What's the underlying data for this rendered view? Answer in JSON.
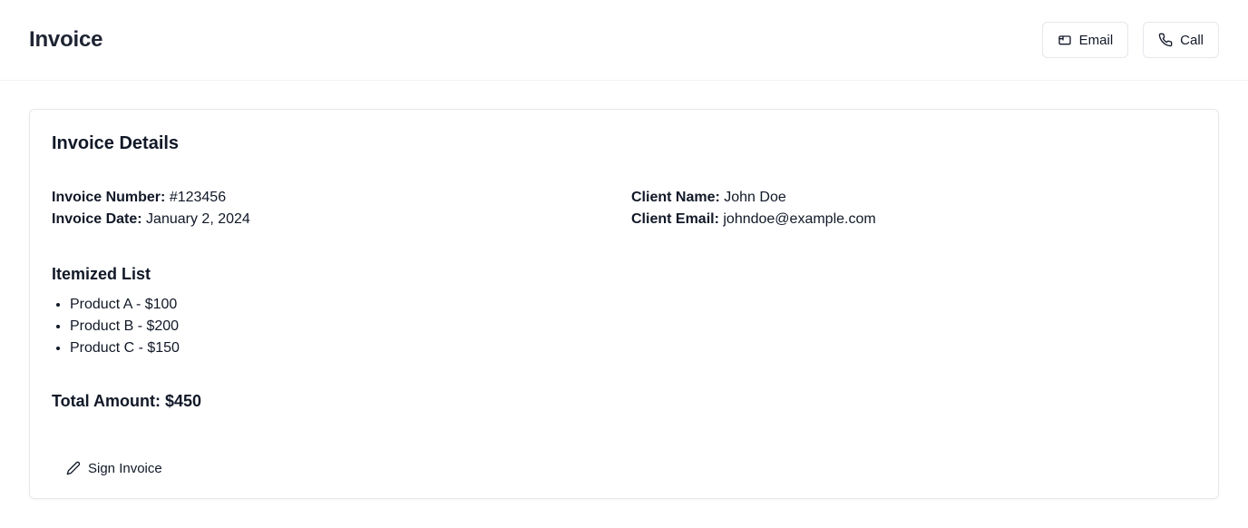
{
  "header": {
    "title": "Invoice",
    "email_label": "Email",
    "call_label": "Call"
  },
  "card": {
    "title": "Invoice Details",
    "invoice_number_label": "Invoice Number:",
    "invoice_number_value": "#123456",
    "invoice_date_label": "Invoice Date:",
    "invoice_date_value": "January 2, 2024",
    "client_name_label": "Client Name:",
    "client_name_value": "John Doe",
    "client_email_label": "Client Email:",
    "client_email_value": "johndoe@example.com",
    "itemized_title": "Itemized List",
    "items": [
      {
        "label": "Product A - $100"
      },
      {
        "label": "Product B - $200"
      },
      {
        "label": "Product C - $150"
      }
    ],
    "total": "Total Amount: $450",
    "sign_label": "Sign Invoice"
  },
  "icons": {
    "email": "email-card-icon",
    "call": "phone-icon",
    "sign": "pencil-icon"
  }
}
